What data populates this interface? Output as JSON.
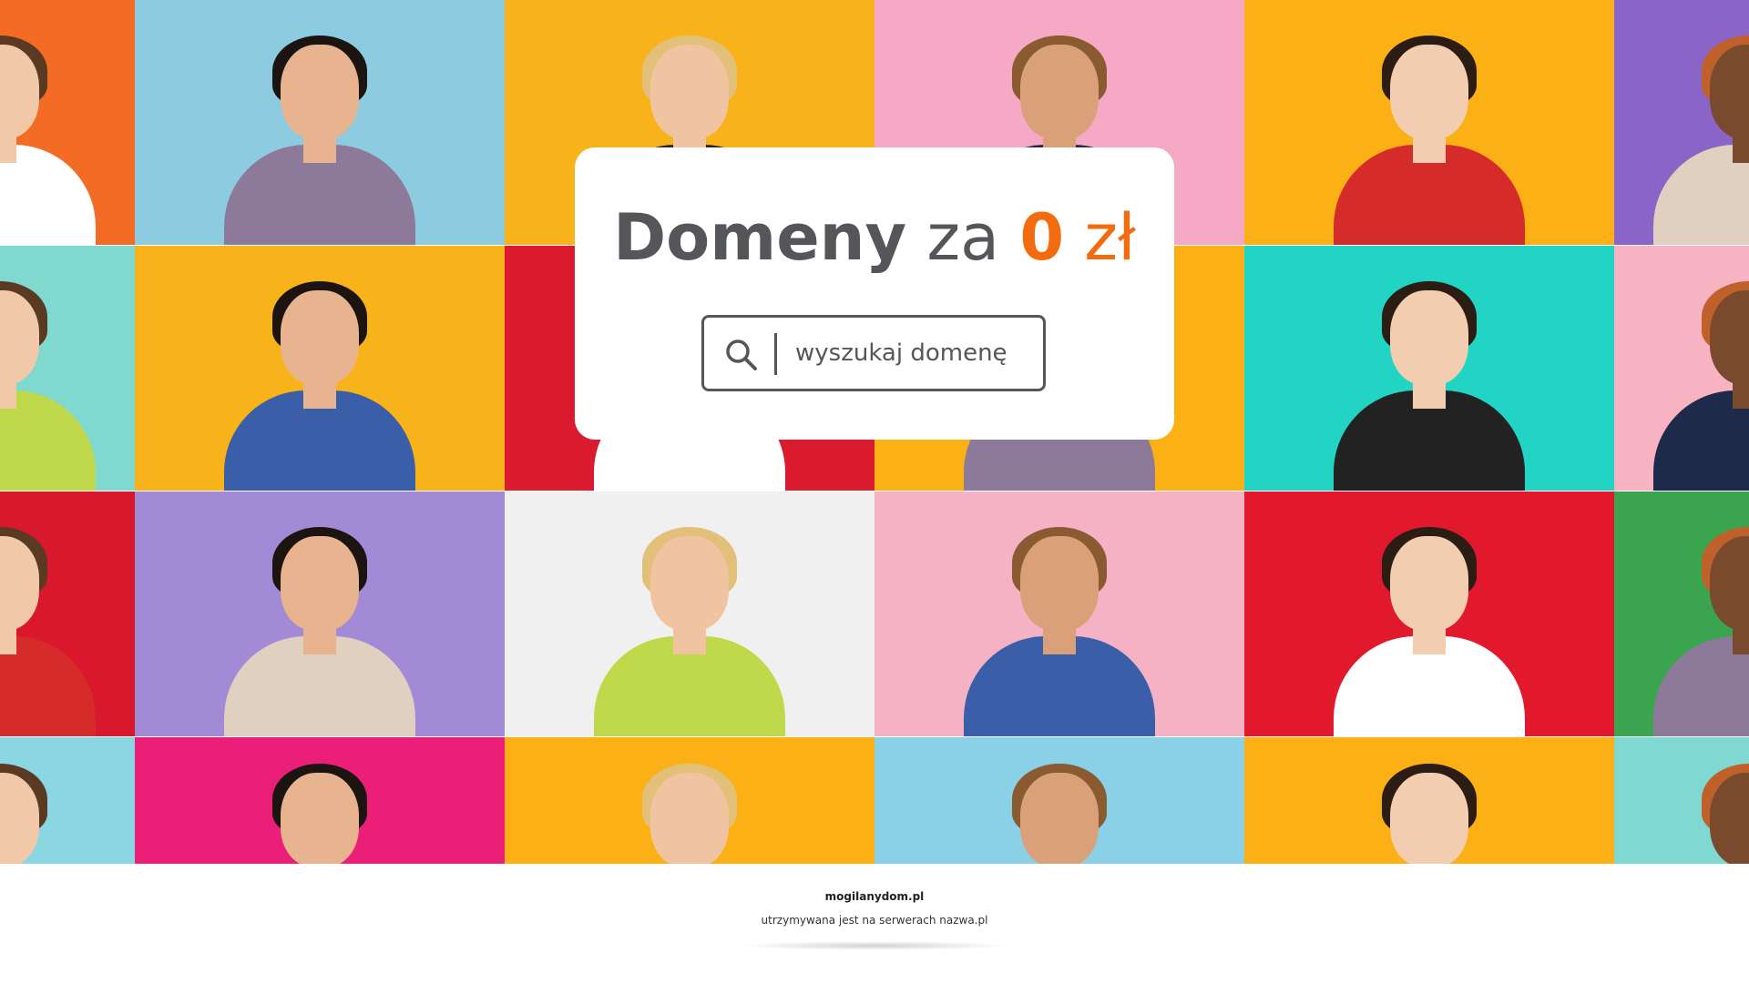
{
  "hero": {
    "headline_word1": "Domeny",
    "headline_word2": "za",
    "headline_word3": "0",
    "headline_word4": "zł"
  },
  "search": {
    "placeholder": "wyszukaj domenę",
    "icon": "search-icon"
  },
  "footer": {
    "domain": "mogilanydom.pl",
    "note": "utrzymywana jest na serwerach nazwa.pl"
  },
  "colors": {
    "accent": "#f26b0f",
    "text": "#555659"
  },
  "mosaic_tiles": [
    {
      "bg": "#f36b24"
    },
    {
      "bg": "#8ccbe0"
    },
    {
      "bg": "#f9b31a"
    },
    {
      "bg": "#f6a9c4"
    },
    {
      "bg": "#fbb016"
    },
    {
      "bg": "#8b64c7"
    },
    {
      "bg": "#7fd9cf"
    },
    {
      "bg": "#f9b31a"
    },
    {
      "bg": "#d91a2f"
    },
    {
      "bg": "#fbb016"
    },
    {
      "bg": "#22d4c4"
    },
    {
      "bg": "#f8b3c3"
    },
    {
      "bg": "#d9172d"
    },
    {
      "bg": "#a38ad6"
    },
    {
      "bg": "#f0f0f0"
    },
    {
      "bg": "#f6b2c5"
    },
    {
      "bg": "#e2182c"
    },
    {
      "bg": "#3aa54e"
    },
    {
      "bg": "#8bd6e3"
    },
    {
      "bg": "#ec1f78"
    },
    {
      "bg": "#fbb016"
    },
    {
      "bg": "#8ad1e8"
    },
    {
      "bg": "#fbb016"
    },
    {
      "bg": "#7fd9d2"
    }
  ]
}
